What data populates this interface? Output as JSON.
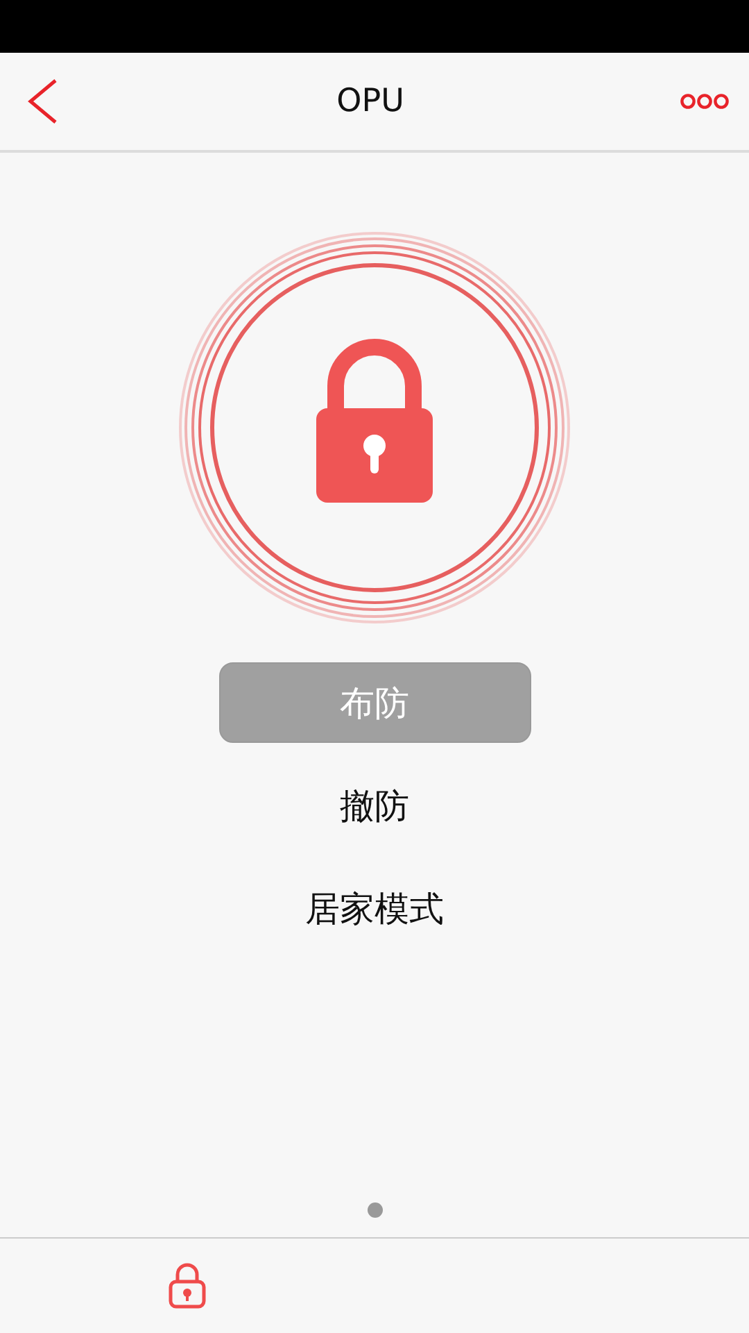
{
  "header": {
    "title": "OPU"
  },
  "modes": [
    {
      "label": "布防",
      "selected": true
    },
    {
      "label": "撤防",
      "selected": false
    },
    {
      "label": "居家模式",
      "selected": false
    }
  ]
}
